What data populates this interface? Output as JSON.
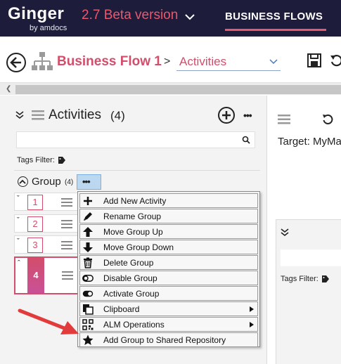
{
  "header": {
    "logo": "Ginger",
    "logo_sub": "by amdocs",
    "version": "2.7 Beta version",
    "nav_item": "BUSINESS FLOWS"
  },
  "breadcrumb": {
    "title": "Business Flow 1",
    "separator": ">",
    "selected": "Activities"
  },
  "activities": {
    "title": "Activities",
    "count": "(4)",
    "tags_filter": "Tags Filter:",
    "group": {
      "label": "Group",
      "count": "(4)",
      "more": "•••"
    },
    "rows": [
      {
        "num": "1"
      },
      {
        "num": "2"
      },
      {
        "num": "3"
      },
      {
        "num": "4"
      }
    ]
  },
  "right_panel": {
    "target": "Target: MyMa",
    "tags_filter": "Tags Filter:"
  },
  "context_menu": {
    "items": [
      {
        "label": "Add New Activity",
        "icon": "plus-icon"
      },
      {
        "label": "Rename Group",
        "icon": "pencil-icon"
      },
      {
        "label": "Move Group Up",
        "icon": "arrow-up-icon"
      },
      {
        "label": "Move Group Down",
        "icon": "arrow-down-icon"
      },
      {
        "label": "Delete Group",
        "icon": "trash-icon"
      },
      {
        "label": "Disable Group",
        "icon": "toggle-off-icon"
      },
      {
        "label": "Activate Group",
        "icon": "toggle-on-icon"
      },
      {
        "label": "Clipboard",
        "icon": "clipboard-icon",
        "submenu": true
      },
      {
        "label": "ALM Operations",
        "icon": "qr-icon",
        "submenu": true
      },
      {
        "label": "Add Group to Shared Repository",
        "icon": "star-icon"
      }
    ]
  },
  "colors": {
    "header_bg": "#1d1c3b",
    "accent": "#d24e6b",
    "arrow": "#e23b3b"
  }
}
